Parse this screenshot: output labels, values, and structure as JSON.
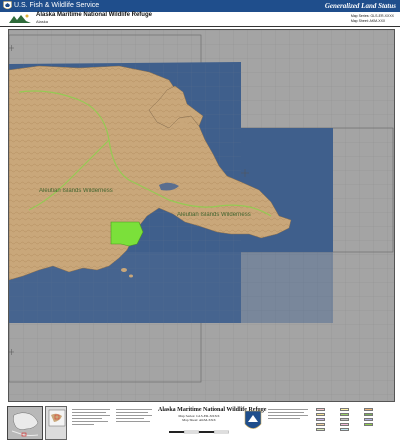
{
  "header": {
    "agency": "U.S. Fish & Wildlife Service",
    "status_title": "Generalized Land Status"
  },
  "title": {
    "refuge": "Alaska Maritime National Wildlife Refuge",
    "state": "Alaska",
    "map_series": "Map Series: GLS-ER-XXXX",
    "map_sheet": "Map Sheet: AKM-XXX"
  },
  "map": {
    "labels": {
      "wilderness_west": "Aleutian Islands Wilderness",
      "wilderness_east": "Aleutian Islands Wilderness"
    },
    "colors": {
      "background": "#a4a4a4",
      "ocean": "#3f5f8c",
      "land": "#c9a77a",
      "wilderness_line": "#8fcf4f",
      "highlight_parcel": "#7be03a"
    }
  },
  "footer": {
    "title": "Alaska Maritime National Wildlife Refuge",
    "map_series": "Map Series: GLS-ER-XXXX",
    "map_sheet": "Map Sheet: AKM-XXX"
  },
  "legend": {
    "swatch_colors": [
      "#f4c6c6",
      "#f7e39a",
      "#c9b6e4",
      "#f2d2a6",
      "#d3e7b5",
      "#fff1a8",
      "#9bd16b",
      "#c6c6c6",
      "#f1b8d8",
      "#bfe3f2",
      "#e8b37a",
      "#7ab05a",
      "#b0b0e0",
      "#8fcf4f"
    ]
  }
}
